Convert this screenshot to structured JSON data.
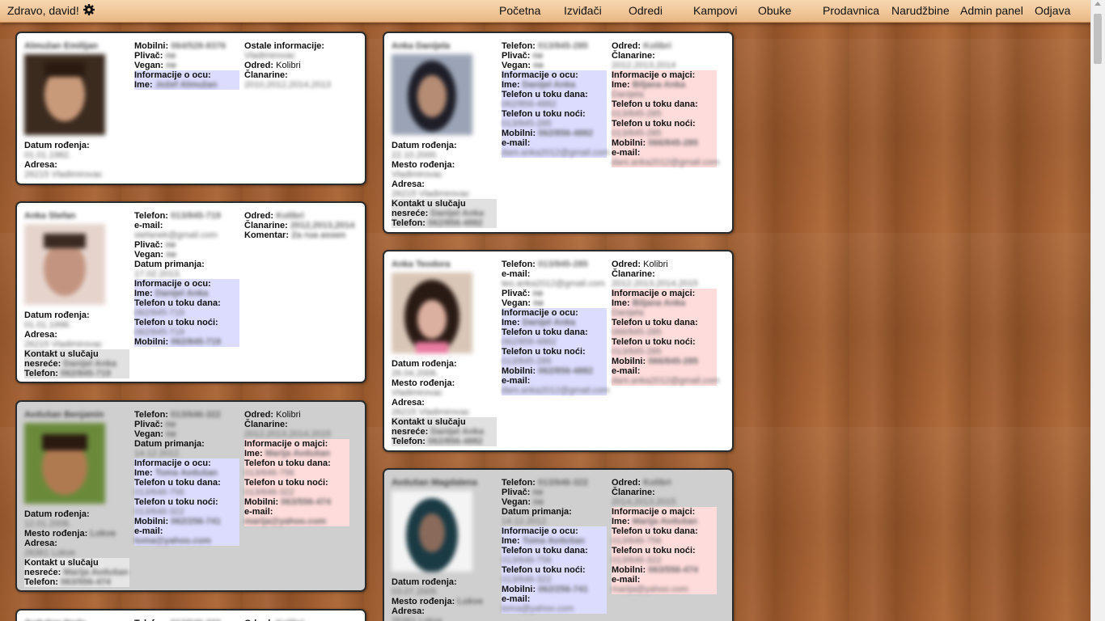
{
  "header": {
    "greeting": "Zdravo, david!",
    "nav": [
      "Početna",
      "Izviđači",
      "Odredi",
      "Kampovi",
      "Obuke",
      "Prodavnica",
      "Narudžbine",
      "Admin panel",
      "Odjava"
    ]
  },
  "labels": {
    "mobilni": "Mobilni:",
    "telefon": "Telefon:",
    "plivac": "Plivač:",
    "vegan": "Vegan:",
    "email": "e-mail:",
    "info_otac": "Informacije o ocu:",
    "info_majka": "Informacije o majci:",
    "ime": "Ime:",
    "tel_dan": "Telefon u toku dana:",
    "tel_noc": "Telefon u toku noći:",
    "datum_rodjenja": "Datum rođenja:",
    "mesto_rodjenja": "Mesto rođenja:",
    "adresa": "Adresa:",
    "kontakt1": "Kontakt u slučaju",
    "kontakt2": "nesreće:",
    "ostale": "Ostale informacije:",
    "odred": "Odred:",
    "clanarine": "Članarine:",
    "komentar": "Komentar:",
    "datum_primanja": "Datum primanja:"
  },
  "values": {
    "odred_kolibri": "Kolibri"
  },
  "colors": {
    "topbar": "#f0c597",
    "father_box": "#dcdcff",
    "mother_box": "#ffdcdc",
    "grey_card": "#cfcfcf"
  }
}
